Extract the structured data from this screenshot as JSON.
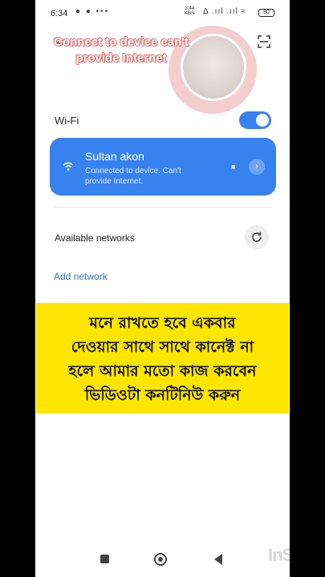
{
  "status_bar": {
    "time": "6:34",
    "left_icons": "● ● •••",
    "net_speed_value": "3.44",
    "net_speed_unit": "KB/s",
    "right_icons": "Δ .ııl .ııl ≈",
    "battery": "80"
  },
  "header": {
    "back_icon": "←",
    "overlay_text": "Connect to device can't provide Internet"
  },
  "wifi": {
    "label": "Wi-Fi",
    "enabled": true,
    "accent_color": "#3882f0"
  },
  "connected_network": {
    "ssid": "Sultan akon",
    "status": "Connected to device. Can't provide Internet.",
    "lock_icon": "🔒",
    "arrow_icon": "›"
  },
  "available": {
    "label": "Available networks"
  },
  "add_network": {
    "label": "Add network"
  },
  "banner": {
    "lines": [
      "মনে রাখতে হবে একবার",
      "দেওয়ার সাথে সাথে কানেক্ট না",
      "হলে আমার মতো কাজ করবেন",
      "ভিডিওটা কনটিনিউ করুন"
    ],
    "background": "#ffe600"
  },
  "watermark": "InShOt"
}
